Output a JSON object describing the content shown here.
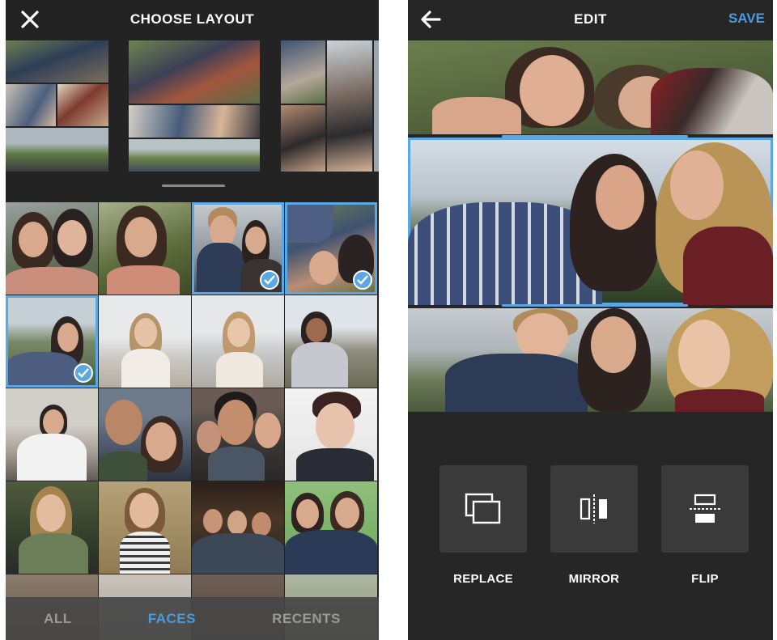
{
  "left": {
    "title": "CHOOSE LAYOUT",
    "close_icon": "close-icon",
    "tabs": [
      {
        "label": "ALL",
        "active": false
      },
      {
        "label": "FACES",
        "active": true
      },
      {
        "label": "RECENTS",
        "active": false
      }
    ],
    "selected_count": 3
  },
  "right": {
    "title": "EDIT",
    "back_icon": "arrow-left-icon",
    "save_label": "SAVE",
    "tools": [
      {
        "label": "REPLACE",
        "icon": "replace-icon"
      },
      {
        "label": "MIRROR",
        "icon": "mirror-icon"
      },
      {
        "label": "FLIP",
        "icon": "flip-icon"
      }
    ]
  },
  "colors": {
    "accent": "#4a9be0",
    "background": "#232323",
    "tool_bg": "#3a3a3a",
    "tab_inactive": "#9a9a9a"
  }
}
